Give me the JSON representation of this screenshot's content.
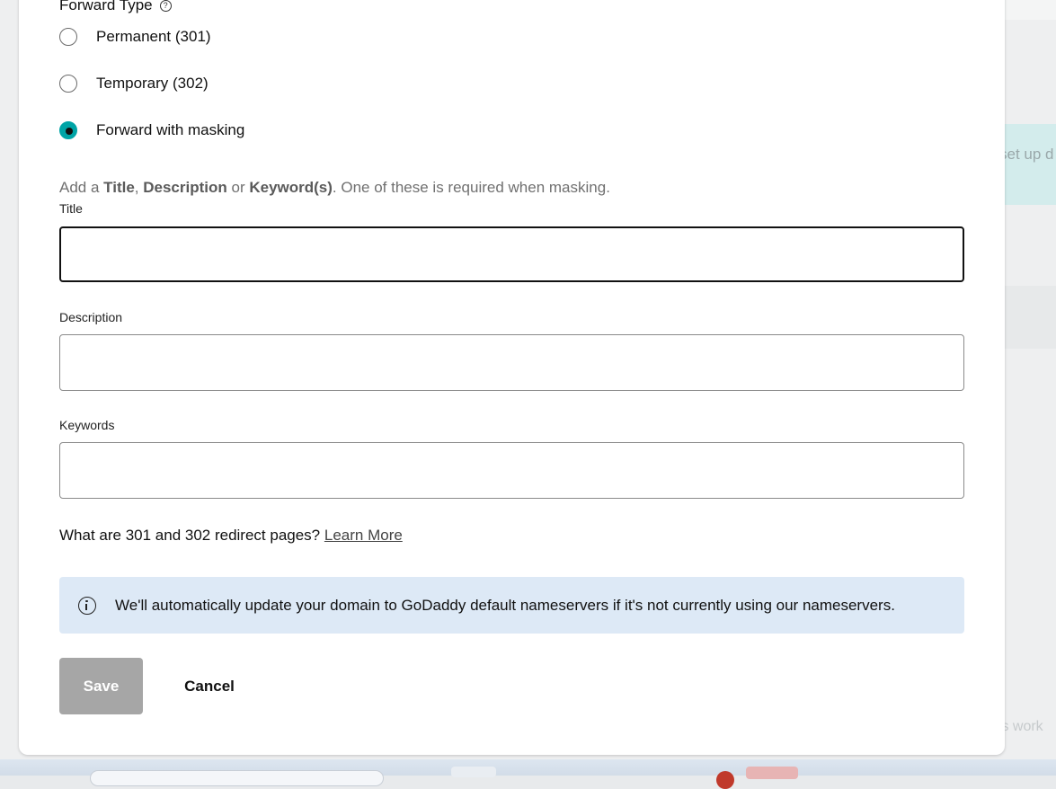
{
  "background": {
    "right_panel_text": "set up d",
    "bottom_right_text": "ts work"
  },
  "forward_type": {
    "title": "Forward Type",
    "help_icon": "question-circle-icon",
    "options": [
      {
        "label": "Permanent (301)",
        "checked": false
      },
      {
        "label": "Temporary (302)",
        "checked": false
      },
      {
        "label": "Forward with masking",
        "checked": true
      }
    ]
  },
  "masking_hint": {
    "prefix": "Add a ",
    "title_word": "Title",
    "sep1": ", ",
    "description_word": "Description",
    "sep2": " or ",
    "keywords_word": "Keyword(s)",
    "suffix": ". One of these is required when masking."
  },
  "fields": {
    "title": {
      "label": "Title",
      "value": "",
      "placeholder": ""
    },
    "description": {
      "label": "Description",
      "value": "",
      "placeholder": ""
    },
    "keywords": {
      "label": "Keywords",
      "value": "",
      "placeholder": ""
    }
  },
  "redirect_info": {
    "question": "What are 301 and 302 redirect pages?",
    "link": "Learn More"
  },
  "info_banner": {
    "icon": "info-circle-icon",
    "text": "We'll automatically update your domain to GoDaddy default nameservers if it's not currently using our nameservers."
  },
  "actions": {
    "save_label": "Save",
    "cancel_label": "Cancel"
  },
  "colors": {
    "accent": "#00a4a6",
    "banner_bg": "#dde9f6",
    "disabled_button": "#a6a6a6"
  }
}
